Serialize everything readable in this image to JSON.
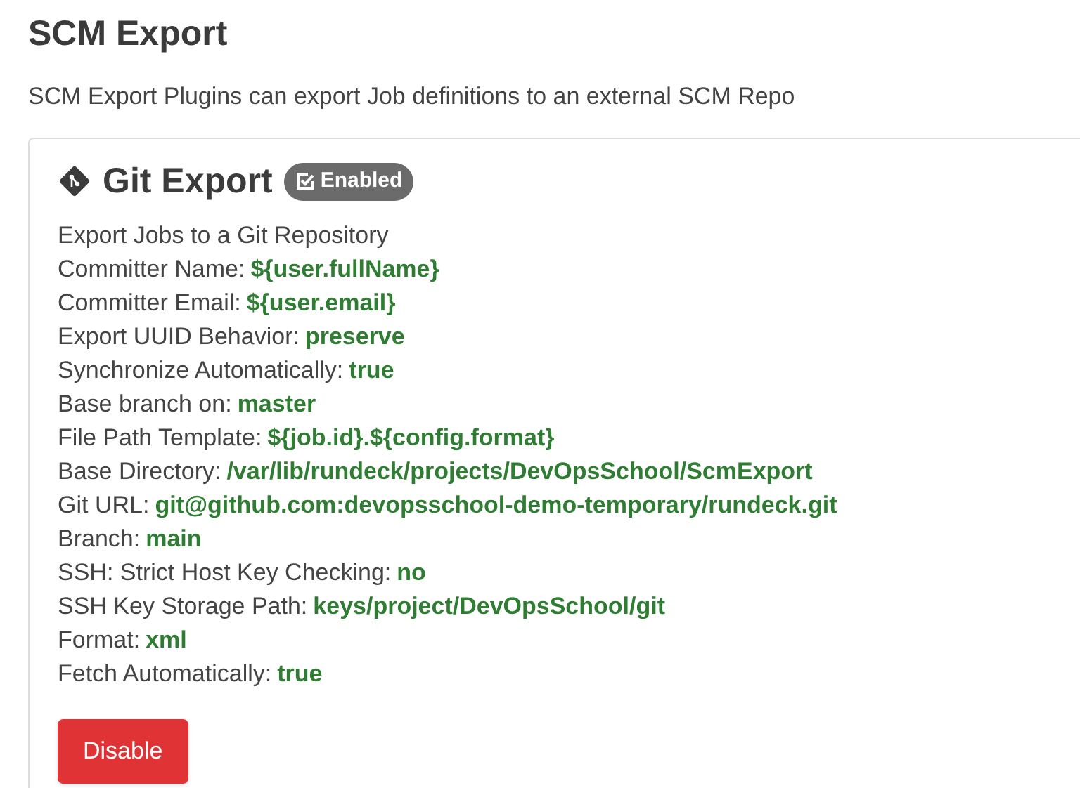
{
  "page": {
    "title": "SCM Export",
    "description": "SCM Export Plugins can export Job definitions to an external SCM Repo"
  },
  "plugin": {
    "title": "Git Export",
    "enabled": true,
    "badge": "Enabled",
    "description": "Export Jobs to a Git Repository",
    "properties": [
      {
        "label": "Committer Name:",
        "value": "${user.fullName}"
      },
      {
        "label": "Committer Email:",
        "value": "${user.email}"
      },
      {
        "label": "Export UUID Behavior:",
        "value": "preserve"
      },
      {
        "label": "Synchronize Automatically:",
        "value": "true"
      },
      {
        "label": "Base branch on:",
        "value": "master"
      },
      {
        "label": "File Path Template:",
        "value": "${job.id}.${config.format}"
      },
      {
        "label": "Base Directory:",
        "value": "/var/lib/rundeck/projects/DevOpsSchool/ScmExport"
      },
      {
        "label": "Git URL:",
        "value": "git@github.com:devopsschool-demo-temporary/rundeck.git"
      },
      {
        "label": "Branch:",
        "value": "main"
      },
      {
        "label": "SSH: Strict Host Key Checking:",
        "value": "no"
      },
      {
        "label": "SSH Key Storage Path:",
        "value": "keys/project/DevOpsSchool/git"
      },
      {
        "label": "Format:",
        "value": "xml"
      },
      {
        "label": "Fetch Automatically:",
        "value": "true"
      }
    ],
    "button": "Disable"
  }
}
